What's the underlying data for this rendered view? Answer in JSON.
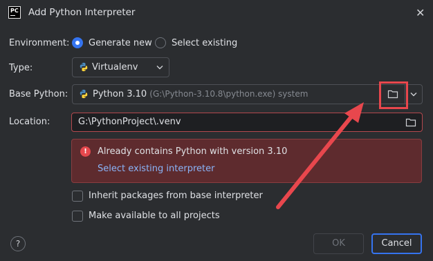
{
  "dialog": {
    "title": "Add Python Interpreter",
    "app_icon_text": "PC",
    "close_glyph": "✕"
  },
  "environment": {
    "label": "Environment:",
    "options": [
      {
        "label": "Generate new",
        "selected": true
      },
      {
        "label": "Select existing",
        "selected": false
      }
    ]
  },
  "type": {
    "label": "Type:",
    "value": "Virtualenv"
  },
  "base_python": {
    "label": "Base Python:",
    "name": "Python 3.10",
    "path": "(G:\\Python-3.10.8\\python.exe) system"
  },
  "location": {
    "label": "Location:",
    "value": "G:\\PythonProject\\.venv"
  },
  "error": {
    "message": "Already contains Python with version 3.10",
    "link": "Select existing interpreter",
    "icon_glyph": "!"
  },
  "checkboxes": [
    {
      "label": "Inherit packages from base interpreter",
      "checked": false
    },
    {
      "label": "Make available to all projects",
      "checked": false
    }
  ],
  "buttons": {
    "help": "?",
    "ok": "OK",
    "cancel": "Cancel"
  },
  "colors": {
    "accent": "#3574f0",
    "error_bg": "#5e2b2e",
    "error_icon": "#e5484d",
    "annotation": "#e8474d"
  },
  "icons": [
    "pycharm-app-icon",
    "close-icon",
    "python-icon",
    "chevron-down-icon",
    "folder-icon",
    "error-icon",
    "help-icon"
  ]
}
